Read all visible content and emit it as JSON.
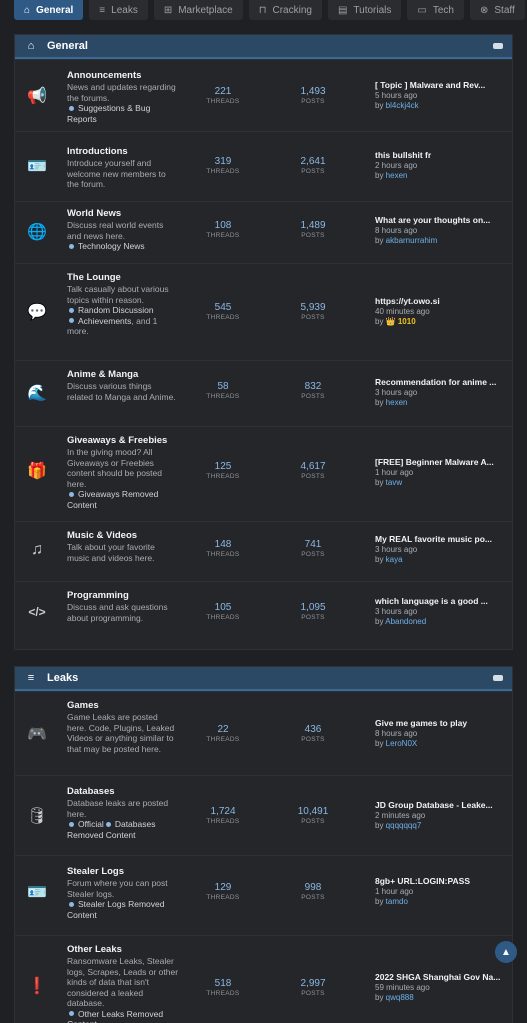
{
  "nav": {
    "tabs": [
      {
        "label": "General",
        "icon": "home-icon",
        "glyph": "⌂"
      },
      {
        "label": "Leaks",
        "icon": "database-icon",
        "glyph": "≡"
      },
      {
        "label": "Marketplace",
        "icon": "cart-icon",
        "glyph": "⊞"
      },
      {
        "label": "Cracking",
        "icon": "unlock-icon",
        "glyph": "⊓"
      },
      {
        "label": "Tutorials",
        "icon": "book-icon",
        "glyph": "▤"
      },
      {
        "label": "Tech",
        "icon": "laptop-icon",
        "glyph": "▭"
      },
      {
        "label": "Staff",
        "icon": "support-icon",
        "glyph": "⊗"
      }
    ]
  },
  "categories": [
    {
      "title": "General",
      "icon": "home-icon",
      "forums": [
        {
          "title": "Announcements",
          "desc": "News and updates regarding the forums.",
          "subforums": [
            "Suggestions & Bug Reports"
          ],
          "threads": "221",
          "posts": "1,493",
          "last_title": "[ Topic ] Malware and Rev...",
          "last_time": "5 hours ago",
          "last_by": "bl4ckj4ck",
          "icon": "megaphone-icon",
          "glyph": "📢"
        },
        {
          "title": "Introductions",
          "desc": "Introduce yourself and welcome new members to the forum.",
          "subforums": [],
          "threads": "319",
          "posts": "2,641",
          "last_title": "this bullshit fr",
          "last_time": "2 hours ago",
          "last_by": "hexen",
          "icon": "id-card-icon",
          "glyph": "🪪"
        },
        {
          "title": "World News",
          "desc": "Discuss real world events and news here.",
          "subforums": [
            "Technology News"
          ],
          "threads": "108",
          "posts": "1,489",
          "last_title": "What are your thoughts on...",
          "last_time": "8 hours ago",
          "last_by": "akbarnurrahim",
          "icon": "globe-icon",
          "glyph": "🌐"
        },
        {
          "title": "The Lounge",
          "desc": "Talk casually about various topics within reason.",
          "subforums": [
            "Random Discussion",
            "Achievements"
          ],
          "subforums_more": ", and 1 more.",
          "threads": "545",
          "posts": "5,939",
          "last_title": "https://yt.owo.si",
          "last_time": "40 minutes ago",
          "last_by": "👑 1010",
          "last_by_gold": true,
          "icon": "chat-icon",
          "glyph": "💬"
        },
        {
          "title": "Anime & Manga",
          "desc": "Discuss various things related to Manga and Anime.",
          "subforums": [],
          "threads": "58",
          "posts": "832",
          "last_title": "Recommendation for anime ...",
          "last_time": "3 hours ago",
          "last_by": "hexen",
          "icon": "wave-icon",
          "glyph": "🌊"
        },
        {
          "title": "Giveaways & Freebies",
          "desc": "In the giving mood? All Giveaways or Freebies content should be posted here.",
          "subforums": [
            "Giveaways Removed Content"
          ],
          "threads": "125",
          "posts": "4,617",
          "last_title": "[FREE] Beginner Malware A...",
          "last_time": "1 hour ago",
          "last_by": "tavw",
          "icon": "gifts-icon",
          "glyph": "🎁"
        },
        {
          "title": "Music & Videos",
          "desc": "Talk about your favorite music and videos here.",
          "subforums": [],
          "threads": "148",
          "posts": "741",
          "last_title": "My REAL favorite music po...",
          "last_time": "3 hours ago",
          "last_by": "kaya",
          "icon": "music-icon",
          "glyph": "♫"
        },
        {
          "title": "Programming",
          "desc": "Discuss and ask questions about programming.",
          "subforums": [],
          "threads": "105",
          "posts": "1,095",
          "last_title": "which language is a good ...",
          "last_time": "3 hours ago",
          "last_by": "Abandoned",
          "icon": "code-icon",
          "glyph": "</>"
        }
      ]
    },
    {
      "title": "Leaks",
      "icon": "database-icon",
      "forums": [
        {
          "title": "Games",
          "desc": "Game Leaks are posted here. Code, Plugins, Leaked Videos or anything similar to that may be posted here.",
          "subforums": [],
          "threads": "22",
          "posts": "436",
          "last_title": "Give me games to play",
          "last_time": "8 hours ago",
          "last_by": "LeroN0X",
          "icon": "gamepad-icon",
          "glyph": "🎮"
        },
        {
          "title": "Databases",
          "desc": "Database leaks are posted here.",
          "subforums": [
            "Official",
            "Databases Removed Content"
          ],
          "threads": "1,724",
          "posts": "10,491",
          "last_title": "JD Group Database - Leake...",
          "last_time": "2 minutes ago",
          "last_by": "qqqqqqq7",
          "icon": "database-icon",
          "glyph": "🛢"
        },
        {
          "title": "Stealer Logs",
          "desc": "Forum where you can post Stealer logs.",
          "subforums": [
            "Stealer Logs Removed Content"
          ],
          "threads": "129",
          "posts": "998",
          "last_title": "8gb+ URL:LOGIN:PASS",
          "last_time": "1 hour ago",
          "last_by": "tamdo",
          "icon": "id-card-icon",
          "glyph": "🪪"
        },
        {
          "title": "Other Leaks",
          "desc": "Ransomware Leaks, Stealer logs, Scrapes, Leads or other kinds of data that isn't considered a leaked database.",
          "subforums": [
            "Other Leaks Removed Content"
          ],
          "threads": "518",
          "posts": "2,997",
          "last_title": "2022 SHGA Shanghai Gov Na...",
          "last_time": "59 minutes ago",
          "last_by": "qwq888",
          "icon": "alert-icon",
          "glyph": "❗"
        }
      ]
    }
  ],
  "labels": {
    "threads": "THREADS",
    "posts": "POSTS",
    "by": "by "
  },
  "scroll_top_icon": "chevron-up-icon",
  "colors": {
    "accent": "#2f5a86",
    "link": "#6fb0e8",
    "gold": "#f0c419",
    "header": "#2b4865"
  }
}
